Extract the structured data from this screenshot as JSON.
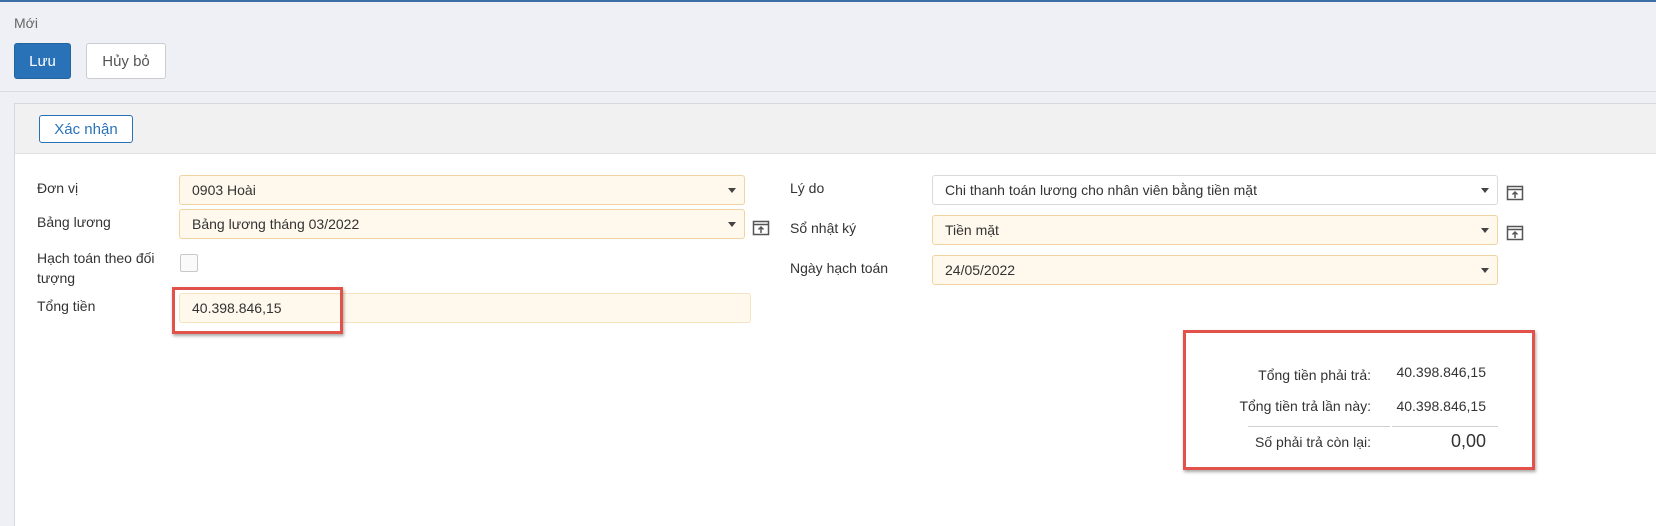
{
  "header": {
    "breadcrumb": "Mới",
    "save_label": "Lưu",
    "cancel_label": "Hủy bỏ"
  },
  "toolbar": {
    "confirm_label": "Xác nhận"
  },
  "form": {
    "don_vi": {
      "label": "Đơn vị",
      "value": "0903 Hoài"
    },
    "bang_luong": {
      "label": "Bảng lương",
      "value": "Bảng lương tháng 03/2022"
    },
    "hach_toan": {
      "label_line1": "Hạch toán theo đối",
      "label_line2": "tượng",
      "checked": false
    },
    "tong_tien": {
      "label": "Tổng tiền",
      "value": "40.398.846,15"
    },
    "ly_do": {
      "label": "Lý do",
      "value": "Chi thanh toán lương cho nhân viên bằng tiền mặt"
    },
    "so_nhat_ky": {
      "label": "Sổ nhật ký",
      "value": "Tiền mặt"
    },
    "ngay_hach_toan": {
      "label": "Ngày hạch toán",
      "value": "24/05/2022"
    }
  },
  "summary": {
    "tong_phai_tra": {
      "label": "Tổng tiền phải trả:",
      "value": "40.398.846,15"
    },
    "tong_tra_lan_nay": {
      "label": "Tổng tiền trả lần này:",
      "value": "40.398.846,15"
    },
    "con_lai": {
      "label": "Số phải trả còn lại:",
      "value": "0,00"
    }
  },
  "icons": {
    "open_external": "open-external-icon",
    "dropdown": "chevron-down-icon"
  },
  "colors": {
    "primary": "#2a72b8",
    "required_field_bg": "#fff8ec",
    "highlight": "#e0524a"
  }
}
